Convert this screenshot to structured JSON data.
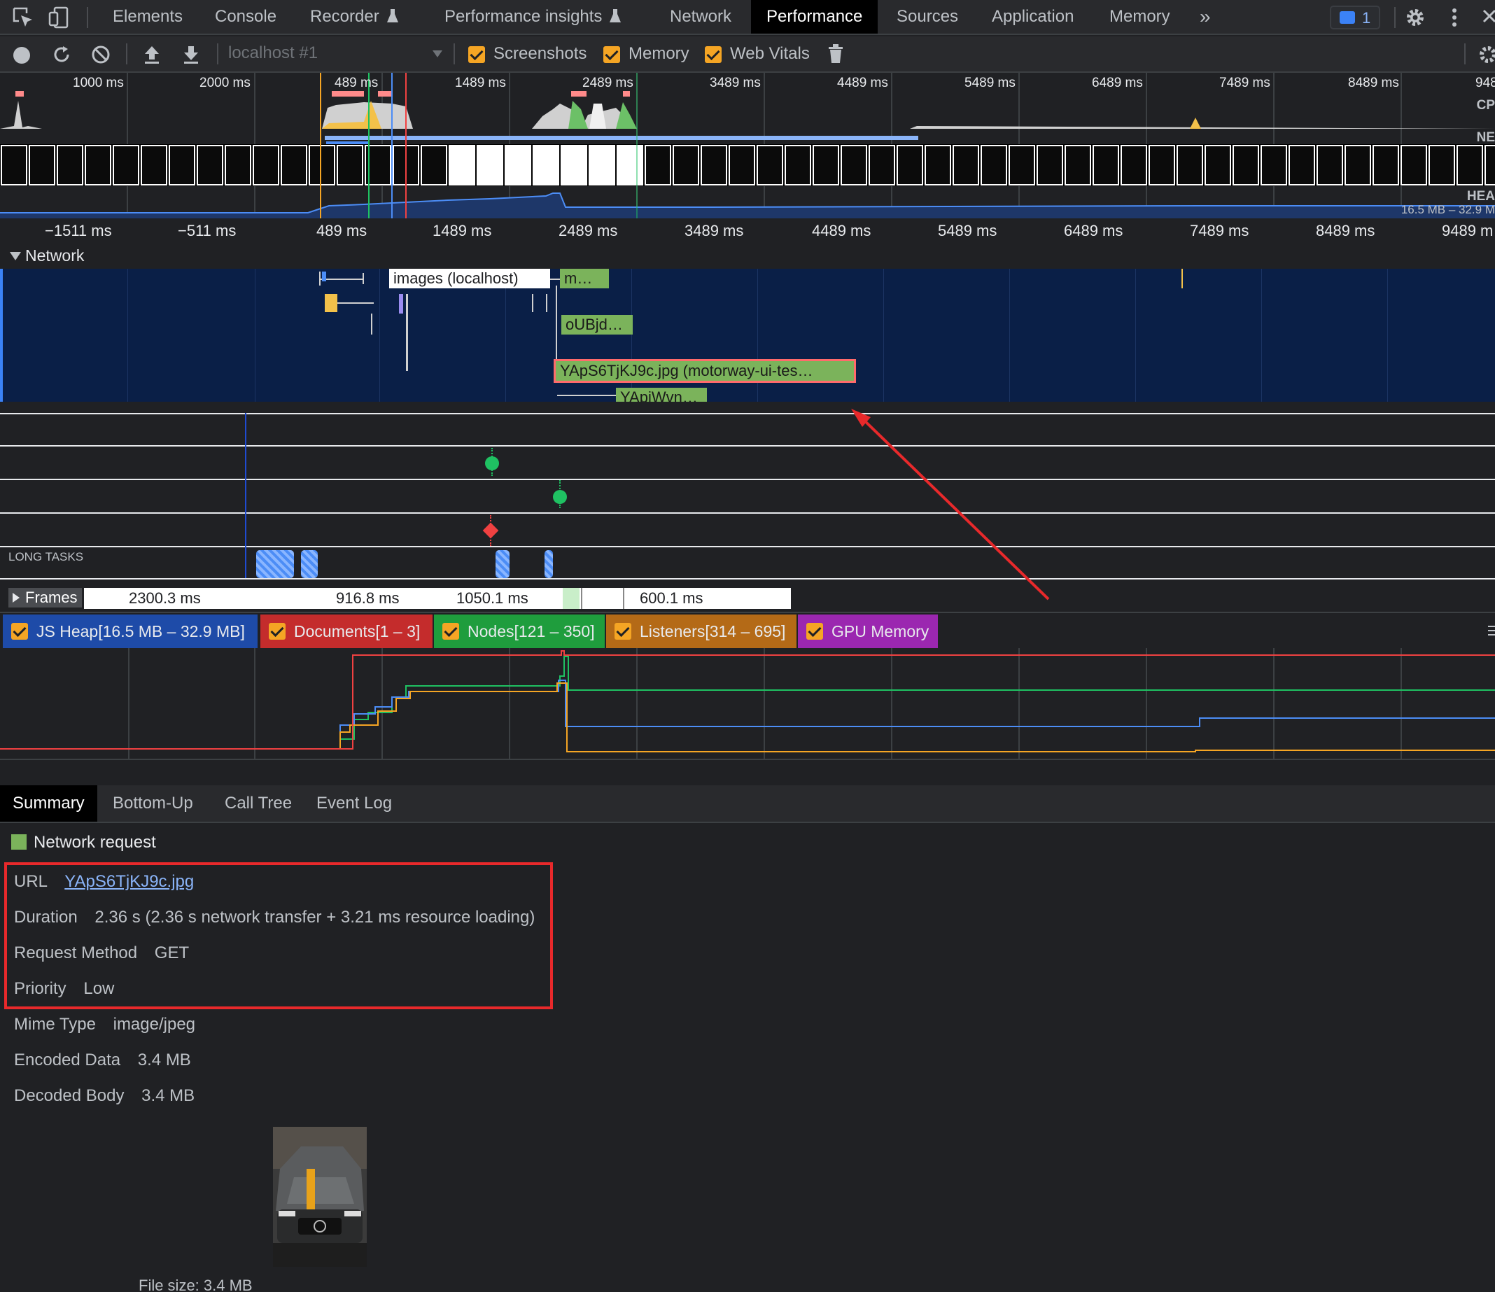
{
  "tabs": {
    "items": [
      {
        "label": "Elements"
      },
      {
        "label": "Console"
      },
      {
        "label": "Recorder"
      },
      {
        "label": "Performance insights"
      },
      {
        "label": "Network"
      },
      {
        "label": "Performance"
      },
      {
        "label": "Sources"
      },
      {
        "label": "Application"
      },
      {
        "label": "Memory"
      }
    ],
    "more": "»",
    "issues_count": "1",
    "active": "Performance"
  },
  "toolbar": {
    "target": "localhost #1",
    "screenshots_label": "Screenshots",
    "memory_label": "Memory",
    "webvitals_label": "Web Vitals"
  },
  "overview": {
    "labels": [
      "1000 ms",
      "2000 ms",
      "489 ms",
      "1489 ms",
      "2489 ms",
      "3489 ms",
      "4489 ms",
      "5489 ms",
      "6489 ms",
      "7489 ms",
      "8489 ms",
      "948"
    ],
    "cpu_label": "CP",
    "net_label": "NE",
    "heap_label": "HEA",
    "heap_range": "16.5 MB – 32.9 M"
  },
  "ruler": {
    "labels": [
      "−1511 ms",
      "−511 ms",
      "489 ms",
      "1489 ms",
      "2489 ms",
      "3489 ms",
      "4489 ms",
      "5489 ms",
      "6489 ms",
      "7489 ms",
      "8489 ms",
      "9489 m"
    ]
  },
  "network": {
    "title": "Network",
    "requests": [
      {
        "label": "images (localhost)"
      },
      {
        "label": "m…"
      },
      {
        "label": "oUBjd…"
      },
      {
        "label": "YApS6TjKJ9c.jpg (motorway-ui-tes…"
      },
      {
        "label": "YApiWvn…"
      }
    ],
    "more": "…"
  },
  "tracks": {
    "long_tasks_label": "LONG TASKS",
    "frames_label": "Frames",
    "frames": [
      "2300.3 ms",
      "916.8 ms",
      "1050.1 ms",
      "600.1 ms"
    ]
  },
  "counters": {
    "js_heap": "JS Heap[16.5 MB – 32.9 MB]",
    "documents": "Documents[1 – 3]",
    "nodes": "Nodes[121 – 350]",
    "listeners": "Listeners[314 – 695]",
    "gpu": "GPU Memory",
    "colors": {
      "js_heap": "#1e4ba8",
      "documents": "#c42c2c",
      "nodes": "#1f9d3d",
      "listeners": "#b46a17",
      "gpu": "#9b27b0"
    }
  },
  "bottom_tabs": {
    "items": [
      {
        "label": "Summary"
      },
      {
        "label": "Bottom-Up"
      },
      {
        "label": "Call Tree"
      },
      {
        "label": "Event Log"
      }
    ],
    "active": "Summary"
  },
  "summary": {
    "title": "Network request",
    "url_key": "URL",
    "url_value": "YApS6TjKJ9c.jpg",
    "duration_key": "Duration",
    "duration_value": "2.36 s (2.36 s network transfer + 3.21 ms resource loading)",
    "method_key": "Request Method",
    "method_value": "GET",
    "priority_key": "Priority",
    "priority_value": "Low",
    "mime_key": "Mime Type",
    "mime_value": "image/jpeg",
    "encoded_key": "Encoded Data",
    "encoded_value": "3.4 MB",
    "decoded_key": "Decoded Body",
    "decoded_value": "3.4 MB",
    "filesize_partial": "File size: 3.4 MB"
  }
}
